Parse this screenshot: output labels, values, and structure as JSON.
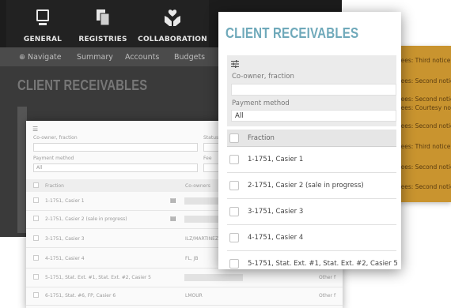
{
  "background_app": {
    "nav": [
      {
        "label": "GENERAL",
        "icon": "monitor-icon"
      },
      {
        "label": "REGISTRIES",
        "icon": "documents-icon"
      },
      {
        "label": "COLLABORATION",
        "icon": "hands-heart-icon"
      }
    ],
    "subnav": [
      "Navigate",
      "Summary",
      "Accounts",
      "Budgets"
    ],
    "title": "CLIENT RECEIVABLES"
  },
  "notices": [
    "fees: Third notice",
    "fees: Second notice",
    "fees: Second notice",
    "fees: Courtesy no",
    "fees: Second notice",
    "fees: Third notice",
    "fees: Second notice",
    "fees: Third notice",
    "fees: Second notice"
  ],
  "faded_form": {
    "filter_label_1": "Co-owner, fraction",
    "filter_label_2": "Payment method",
    "select_value": "All",
    "col_fraction": "Fraction",
    "col_coowners": "Co-owners",
    "col_status": "Status",
    "col_fee": "Fee",
    "rows": [
      {
        "fraction": "1-1751, Casier 1",
        "coowner": "",
        "extra": ""
      },
      {
        "fraction": "2-1751, Casier 2 (sale in progress)",
        "coowner": "",
        "extra": ""
      },
      {
        "fraction": "3-1751, Casier 3",
        "coowner": "ILZ/MARTINEZ",
        "extra": ""
      },
      {
        "fraction": "4-1751, Casier 4",
        "coowner": "FL, JB",
        "extra": ""
      },
      {
        "fraction": "5-1751, Stat. Ext. #1, Stat. Ext. #2, Casier 5",
        "coowner": "",
        "extra": "Other f"
      },
      {
        "fraction": "6-1751, Stat. #6, FP, Casier 6",
        "coowner": "LMOUR",
        "extra": "Other f"
      }
    ]
  },
  "panel": {
    "title": "CLIENT RECEIVABLES",
    "filter_icon": "sliders-icon",
    "coowner_label": "Co-owner, fraction",
    "coowner_value": "",
    "payment_label": "Payment method",
    "payment_value": "All",
    "column_fraction": "Fraction",
    "rows": [
      "1-1751, Casier 1",
      "2-1751, Casier 2 (sale in progress)",
      "3-1751, Casier 3",
      "4-1751, Casier 4",
      "5-1751, Stat. Ext. #1, Stat. Ext. #2, Casier 5"
    ]
  },
  "colors": {
    "title_accent": "#6fa9ba",
    "notices_bg": "#c9942f",
    "nav_bg": "#1c1c1c"
  }
}
